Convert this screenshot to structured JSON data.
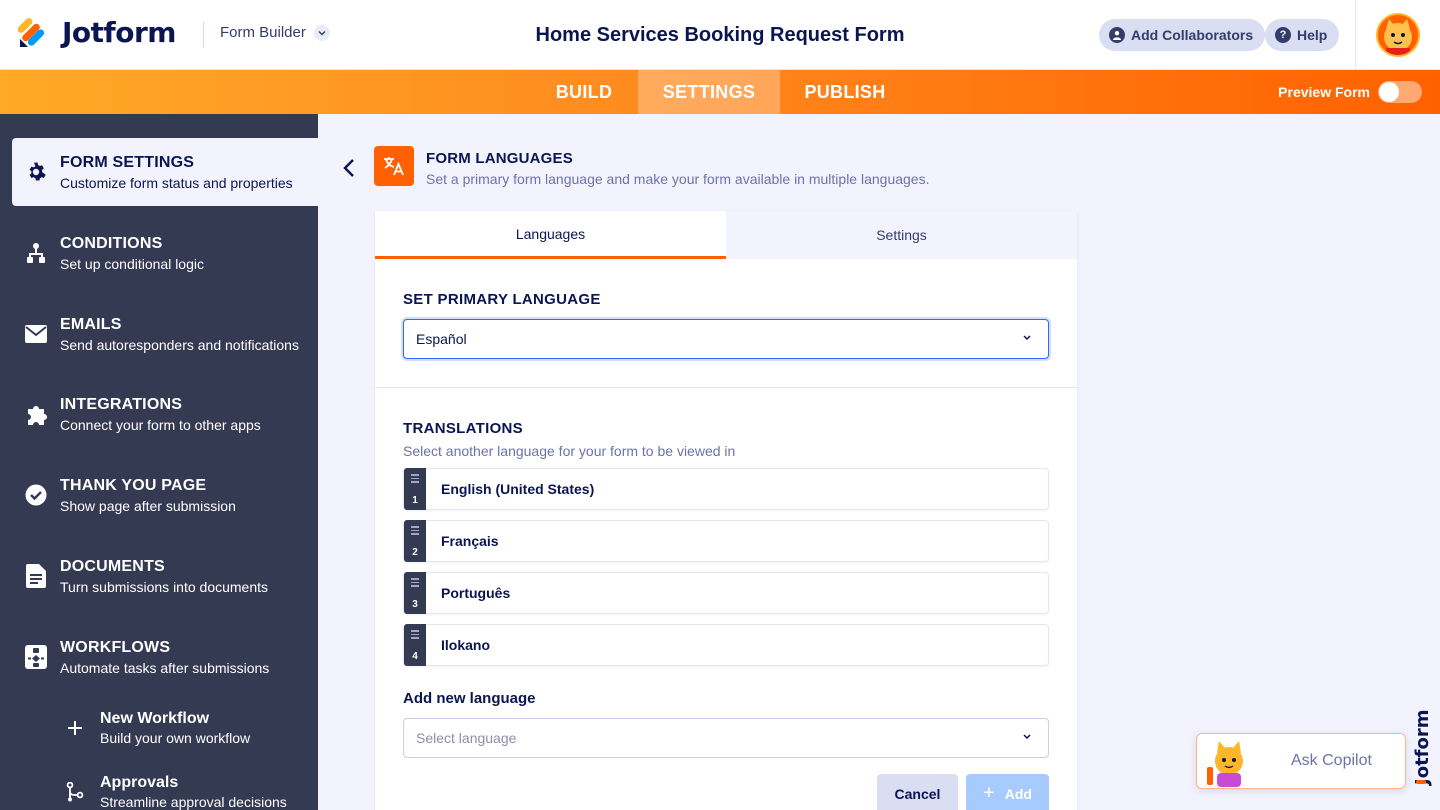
{
  "header": {
    "logo_text": "Jotform",
    "builder_label": "Form Builder",
    "form_title": "Home Services Booking Request Form",
    "add_collaborators": "Add Collaborators",
    "help": "Help"
  },
  "nav": {
    "tabs": [
      {
        "label": "BUILD",
        "active": false
      },
      {
        "label": "SETTINGS",
        "active": true
      },
      {
        "label": "PUBLISH",
        "active": false
      }
    ],
    "preview_label": "Preview Form",
    "preview_on": false
  },
  "sidebar": {
    "items": [
      {
        "title": "FORM SETTINGS",
        "subtitle": "Customize form status and properties",
        "icon": "gear-icon",
        "active": true
      },
      {
        "title": "CONDITIONS",
        "subtitle": "Set up conditional logic",
        "icon": "conditions-icon",
        "active": false
      },
      {
        "title": "EMAILS",
        "subtitle": "Send autoresponders and notifications",
        "icon": "envelope-icon",
        "active": false
      },
      {
        "title": "INTEGRATIONS",
        "subtitle": "Connect your form to other apps",
        "icon": "puzzle-icon",
        "active": false
      },
      {
        "title": "THANK YOU PAGE",
        "subtitle": "Show page after submission",
        "icon": "check-circle-icon",
        "active": false
      },
      {
        "title": "DOCUMENTS",
        "subtitle": "Turn submissions into documents",
        "icon": "document-icon",
        "active": false
      },
      {
        "title": "WORKFLOWS",
        "subtitle": "Automate tasks after submissions",
        "icon": "workflow-icon",
        "active": false
      }
    ],
    "sub_items": [
      {
        "title": "New Workflow",
        "subtitle": "Build your own workflow",
        "icon": "plus-icon"
      },
      {
        "title": "Approvals",
        "subtitle": "Streamline approval decisions",
        "icon": "approvals-icon"
      }
    ]
  },
  "section": {
    "title": "FORM LANGUAGES",
    "subtitle": "Set a primary form language and make your form available in multiple languages."
  },
  "panel": {
    "tabs": [
      {
        "label": "Languages",
        "active": true
      },
      {
        "label": "Settings",
        "active": false
      }
    ],
    "primary_label": "SET PRIMARY LANGUAGE",
    "primary_value": "Español",
    "translations_label": "TRANSLATIONS",
    "translations_helper": "Select another language for your form to be viewed in",
    "translations": [
      {
        "index": "1",
        "name": "English (United States)"
      },
      {
        "index": "2",
        "name": "Français"
      },
      {
        "index": "3",
        "name": "Português"
      },
      {
        "index": "4",
        "name": "Ilokano"
      }
    ],
    "add_label": "Add new language",
    "add_placeholder": "Select language",
    "cancel_label": "Cancel",
    "add_button_label": "Add"
  },
  "copilot": {
    "label": "Ask Copilot"
  },
  "colors": {
    "brand_orange": "#ff6100",
    "navy": "#0a1551",
    "sidebar_bg": "#343a52",
    "focus_blue": "#2e69ff"
  }
}
